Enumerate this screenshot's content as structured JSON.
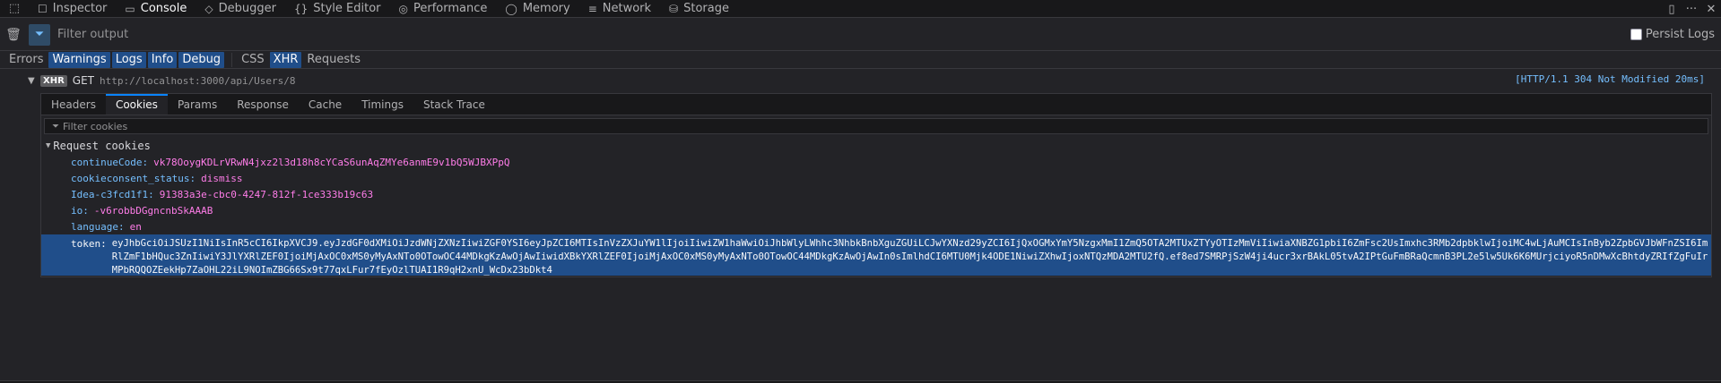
{
  "toolbar": {
    "tabs": [
      {
        "label": "Inspector",
        "icon": "inspector-icon",
        "glyph": "☐"
      },
      {
        "label": "Console",
        "icon": "console-icon",
        "glyph": "▭"
      },
      {
        "label": "Debugger",
        "icon": "debugger-icon",
        "glyph": "◇"
      },
      {
        "label": "Style Editor",
        "icon": "style-editor-icon",
        "glyph": "{}"
      },
      {
        "label": "Performance",
        "icon": "performance-icon",
        "glyph": "◎"
      },
      {
        "label": "Memory",
        "icon": "memory-icon",
        "glyph": "◯"
      },
      {
        "label": "Network",
        "icon": "network-icon",
        "glyph": "≡"
      },
      {
        "label": "Storage",
        "icon": "storage-icon",
        "glyph": "⛁"
      }
    ],
    "active_tab": "Console"
  },
  "filter": {
    "placeholder": "Filter output",
    "persist_label": "Persist Logs"
  },
  "levels": [
    {
      "label": "Errors",
      "on": false
    },
    {
      "label": "Warnings",
      "on": true
    },
    {
      "label": "Logs",
      "on": true
    },
    {
      "label": "Info",
      "on": true
    },
    {
      "label": "Debug",
      "on": true
    }
  ],
  "types": [
    {
      "label": "CSS",
      "on": false
    },
    {
      "label": "XHR",
      "on": true
    },
    {
      "label": "Requests",
      "on": false
    }
  ],
  "request": {
    "badge": "XHR",
    "method": "GET",
    "url": "http://localhost:3000/api/Users/8",
    "status": "[HTTP/1.1  304  Not Modified 20ms]"
  },
  "details": {
    "tabs": [
      "Headers",
      "Cookies",
      "Params",
      "Response",
      "Cache",
      "Timings",
      "Stack Trace"
    ],
    "active_tab": "Cookies",
    "cookie_filter_placeholder": "Filter cookies",
    "section_title": "Request cookies",
    "cookies": [
      {
        "key": "continueCode:",
        "value": "vk78OoygKDLrVRwN4jxz2l3d18h8cYCaS6unAqZMYe6anmE9v1bQ5WJBXPpQ"
      },
      {
        "key": "cookieconsent_status:",
        "value": "dismiss"
      },
      {
        "key": "Idea-c3fcd1f1:",
        "value": "91383a3e-cbc0-4247-812f-1ce333b19c63"
      },
      {
        "key": "io:",
        "value": "-v6robbDGgncnbSkAAAB"
      },
      {
        "key": "language:",
        "value": "en"
      }
    ],
    "selected_cookie": {
      "key": "token:",
      "value": "eyJhbGciOiJSUzI1NiIsInR5cCI6IkpXVCJ9.eyJzdGF0dXMiOiJzdWNjZXNzIiwiZGF0YSI6eyJpZCI6MTIsInVzZXJuYW1lIjoiIiwiZW1haWwiOiJhbWlyLWhhc3NhbkBnbXguZGUiLCJwYXNzd29yZCI6IjQxOGMxYmY5NzgxMmI1ZmQ5OTA2MTUxZTYyOTIzMmViIiwiaXNBZG1pbiI6ZmFsc2UsImxhc3RMb2dpbklwIjoiMC4wLjAuMCIsInByb2ZpbGVJbWFnZSI6ImRlZmF1bHQuc3ZnIiwiY3JlYXRlZEF0IjoiMjAxOC0xMS0yMyAxNTo0OTowOC44MDkgKzAwOjAwIiwidXBkYXRlZEF0IjoiMjAxOC0xMS0yMyAxNTo0OTowOC44MDkgKzAwOjAwIn0sImlhdCI6MTU0Mjk4ODE1NiwiZXhwIjoxNTQzMDA2MTU2fQ.ef8ed7SMRPjSzW4ji4ucr3xrBAkL05tvA2IPtGuFmBRaQcmnB3PL2e5lw5Uk6K6MUrjciyoR5nDMwXcBhtdyZRIfZgFuIrMPbRQQOZEekHp7ZaOHL22iL9NOImZBG66Sx9t77qxLFur7fEyOzlTUAI1R9qH2xnU_WcDx23bDkt4"
    }
  }
}
